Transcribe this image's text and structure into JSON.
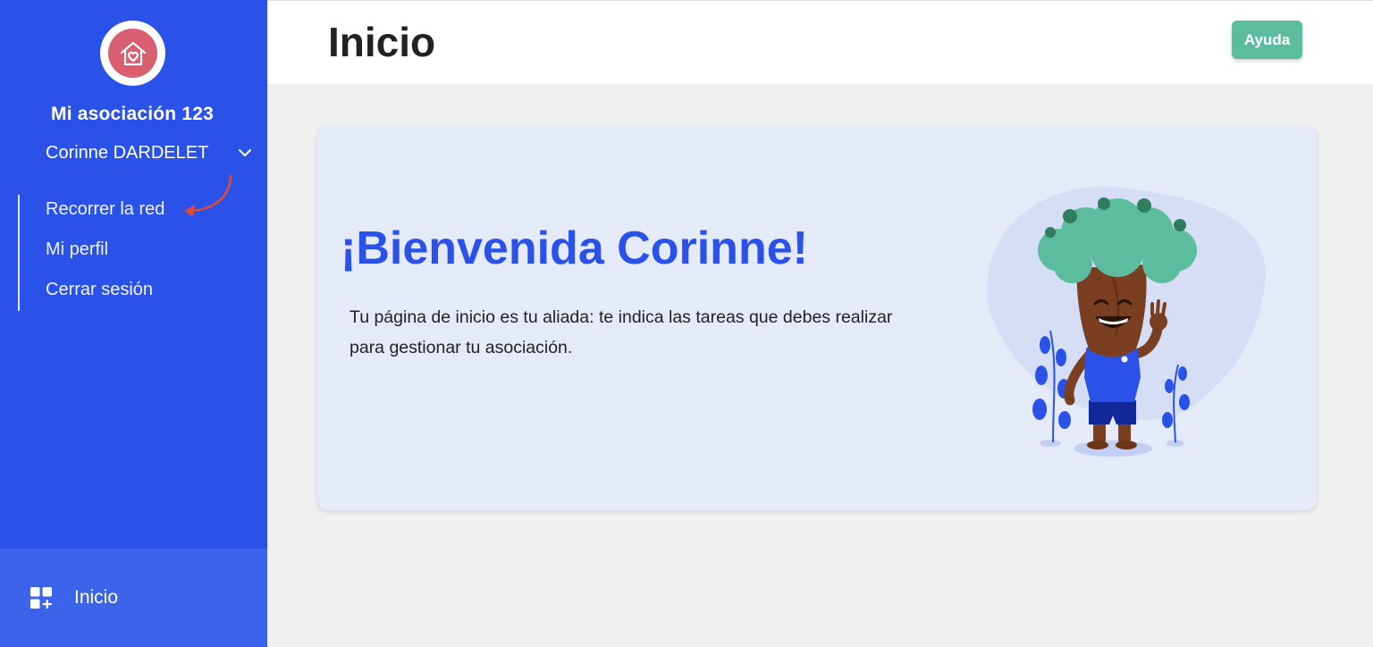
{
  "sidebar": {
    "org_name": "Mi asociación 123",
    "user_name": "Corinne DARDELET",
    "menu": [
      {
        "label": "Recorrer la red"
      },
      {
        "label": "Mi perfil"
      },
      {
        "label": "Cerrar sesión"
      }
    ],
    "nav": {
      "label": "Inicio",
      "icon": "dashboard-add-icon"
    }
  },
  "header": {
    "title": "Inicio",
    "help_label": "Ayuda"
  },
  "welcome": {
    "title": "¡Bienvenida Corinne!",
    "text": "Tu página de inicio es tu aliada: te indica las tareas que debes realizar para gestionar tu asociación."
  },
  "colors": {
    "sidebar": "#2a52e8",
    "accent": "#2a52e8",
    "help_button": "#5bbd9d",
    "logo": "#d95e6f",
    "annotation_arrow": "#e04a3a"
  }
}
